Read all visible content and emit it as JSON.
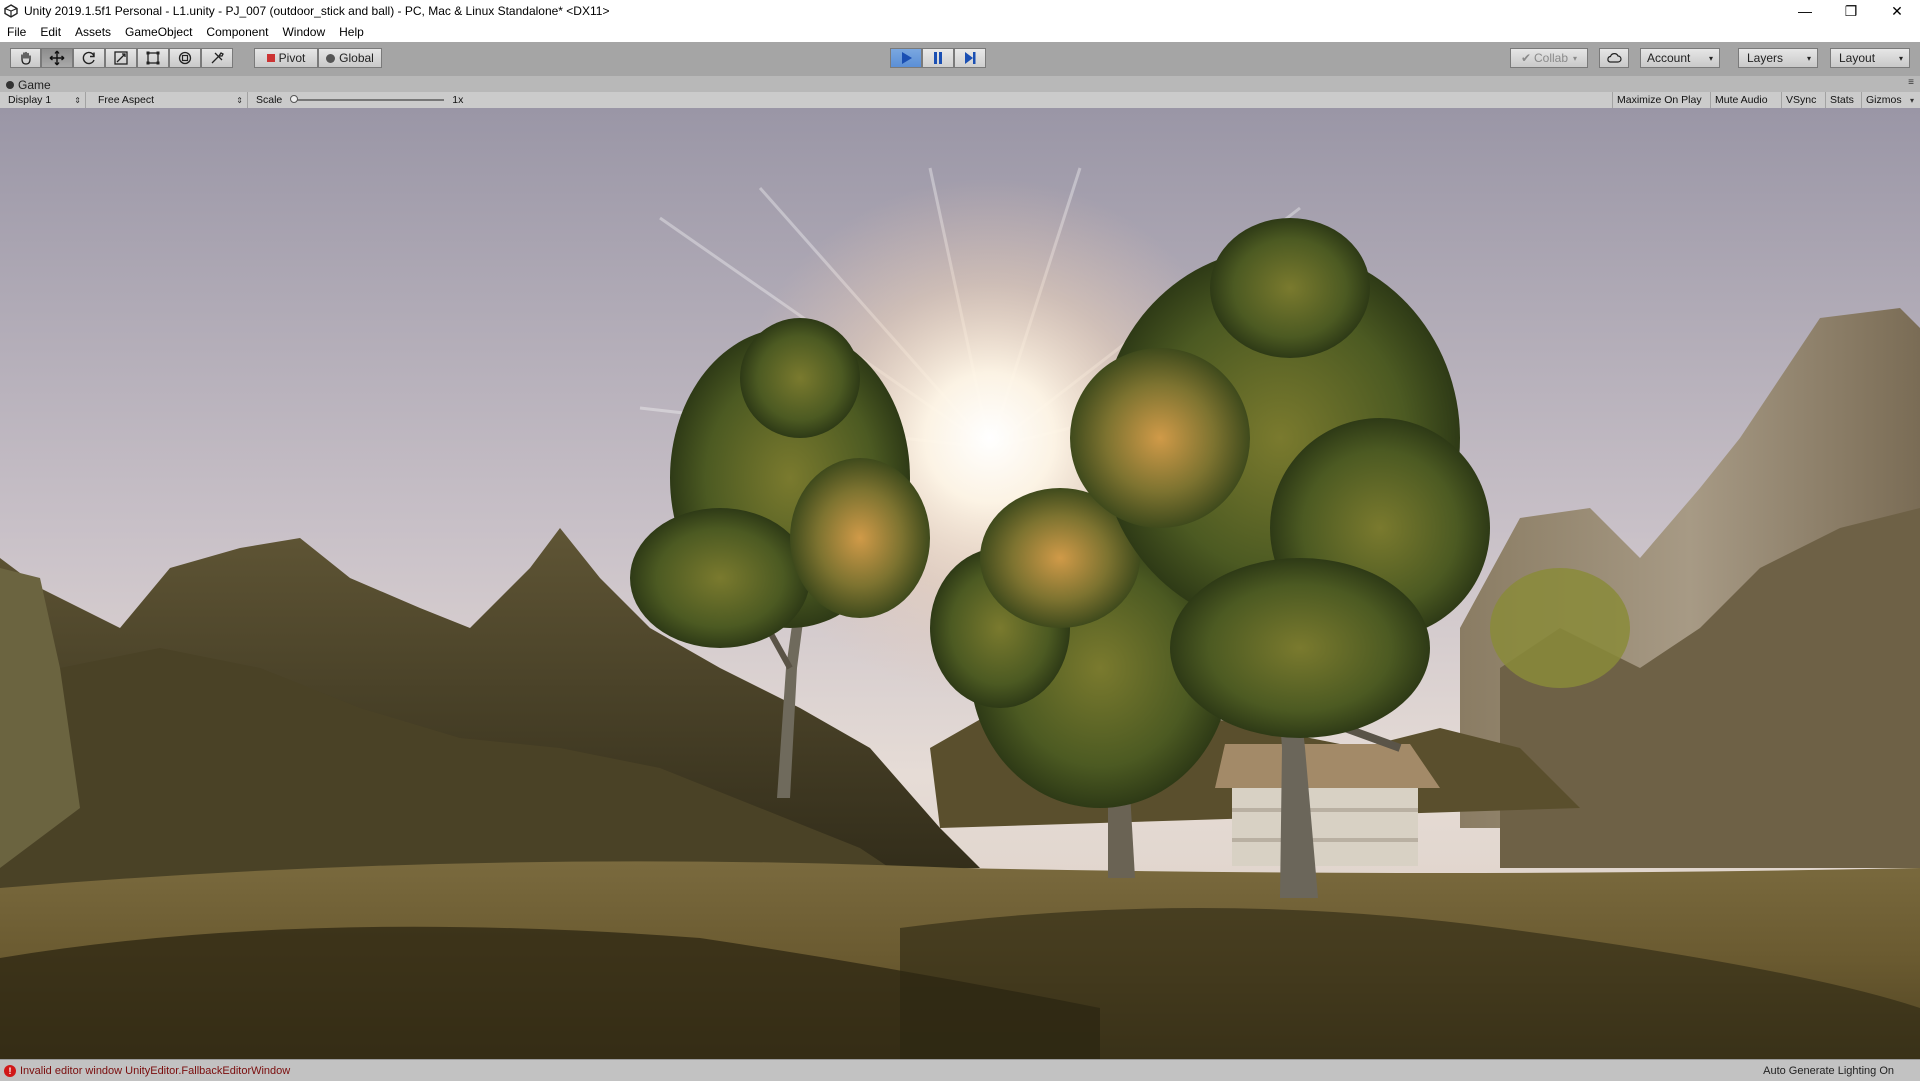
{
  "window": {
    "title": "Unity 2019.1.5f1 Personal - L1.unity - PJ_007 (outdoor_stick and  ball) - PC, Mac & Linux Standalone* <DX11>",
    "controls": {
      "minimize": "—",
      "restore": "❐",
      "close": "✕"
    }
  },
  "menu": {
    "items": [
      "File",
      "Edit",
      "Assets",
      "GameObject",
      "Component",
      "Window",
      "Help"
    ]
  },
  "toolbar": {
    "tools": [
      "hand-tool",
      "move-tool",
      "rotate-tool",
      "scale-tool",
      "rect-tool",
      "transform-tool",
      "custom-tool"
    ],
    "active_tool": "move-tool",
    "pivot_label": "Pivot",
    "global_label": "Global",
    "play_state": "playing",
    "collab_label": "Collab",
    "account_label": "Account",
    "layers_label": "Layers",
    "layout_label": "Layout"
  },
  "game_view": {
    "tab_label": "Game",
    "display": "Display 1",
    "aspect": "Free Aspect",
    "scale_label": "Scale",
    "scale_value": "1x",
    "maximize_on_play": "Maximize On Play",
    "mute_audio": "Mute Audio",
    "vsync": "VSync",
    "stats": "Stats",
    "gizmos": "Gizmos"
  },
  "status": {
    "error_text": "Invalid editor window UnityEditor.FallbackEditorWindow",
    "lighting_text": "Auto Generate Lighting On"
  },
  "colors": {
    "toolbar_bg": "#a5a5a5",
    "play_active": "#5b8fd6",
    "error_red": "#d01818"
  }
}
